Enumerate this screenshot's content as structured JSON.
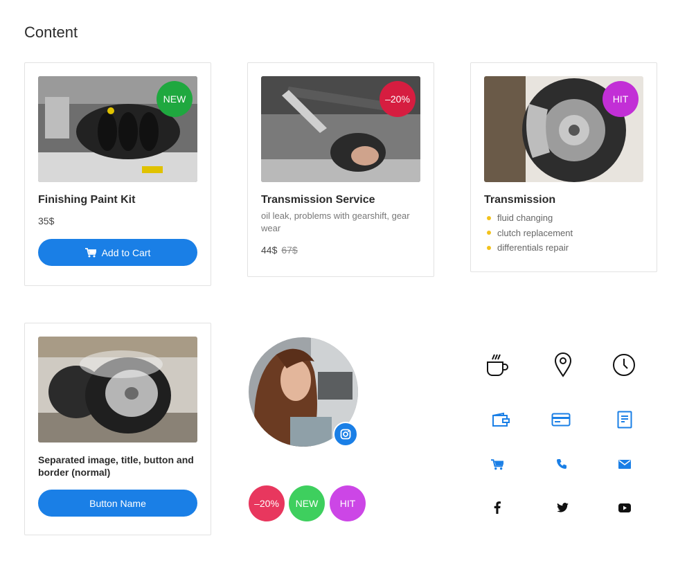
{
  "page": {
    "title": "Content"
  },
  "cards": [
    {
      "badge": "NEW",
      "title": "Finishing Paint Kit",
      "price": "35$",
      "button_label": "Add to Cart"
    },
    {
      "badge": "–20%",
      "title": "Transmission Service",
      "description": "oil leak, problems with gearshift, gear wear",
      "price": "44$",
      "old_price": "67$"
    },
    {
      "badge": "HIT",
      "title": "Transmission",
      "bullets": [
        "fluid changing",
        "clutch replacement",
        "differentials repair"
      ]
    },
    {
      "title": "Separated image, title, button and border (normal)",
      "button_label": "Button Name"
    }
  ],
  "badges": [
    "–20%",
    "NEW",
    "HIT"
  ],
  "icons": {
    "row1": [
      "coffee-icon",
      "location-pin-icon",
      "clock-icon"
    ],
    "row2": [
      "wallet-icon",
      "credit-card-icon",
      "receipt-icon"
    ],
    "row3": [
      "cart-icon",
      "phone-icon",
      "mail-icon"
    ],
    "row4": [
      "facebook-icon",
      "twitter-icon",
      "youtube-icon"
    ]
  },
  "colors": {
    "accent": "#1a7fe6",
    "new": "#1fa83f",
    "sale": "#d61d40",
    "hit": "#c22fd6",
    "bullet": "#f3c21c",
    "free_new": "#3ecf5e",
    "free_sale": "#e8375e",
    "free_hit": "#cc46e6"
  }
}
